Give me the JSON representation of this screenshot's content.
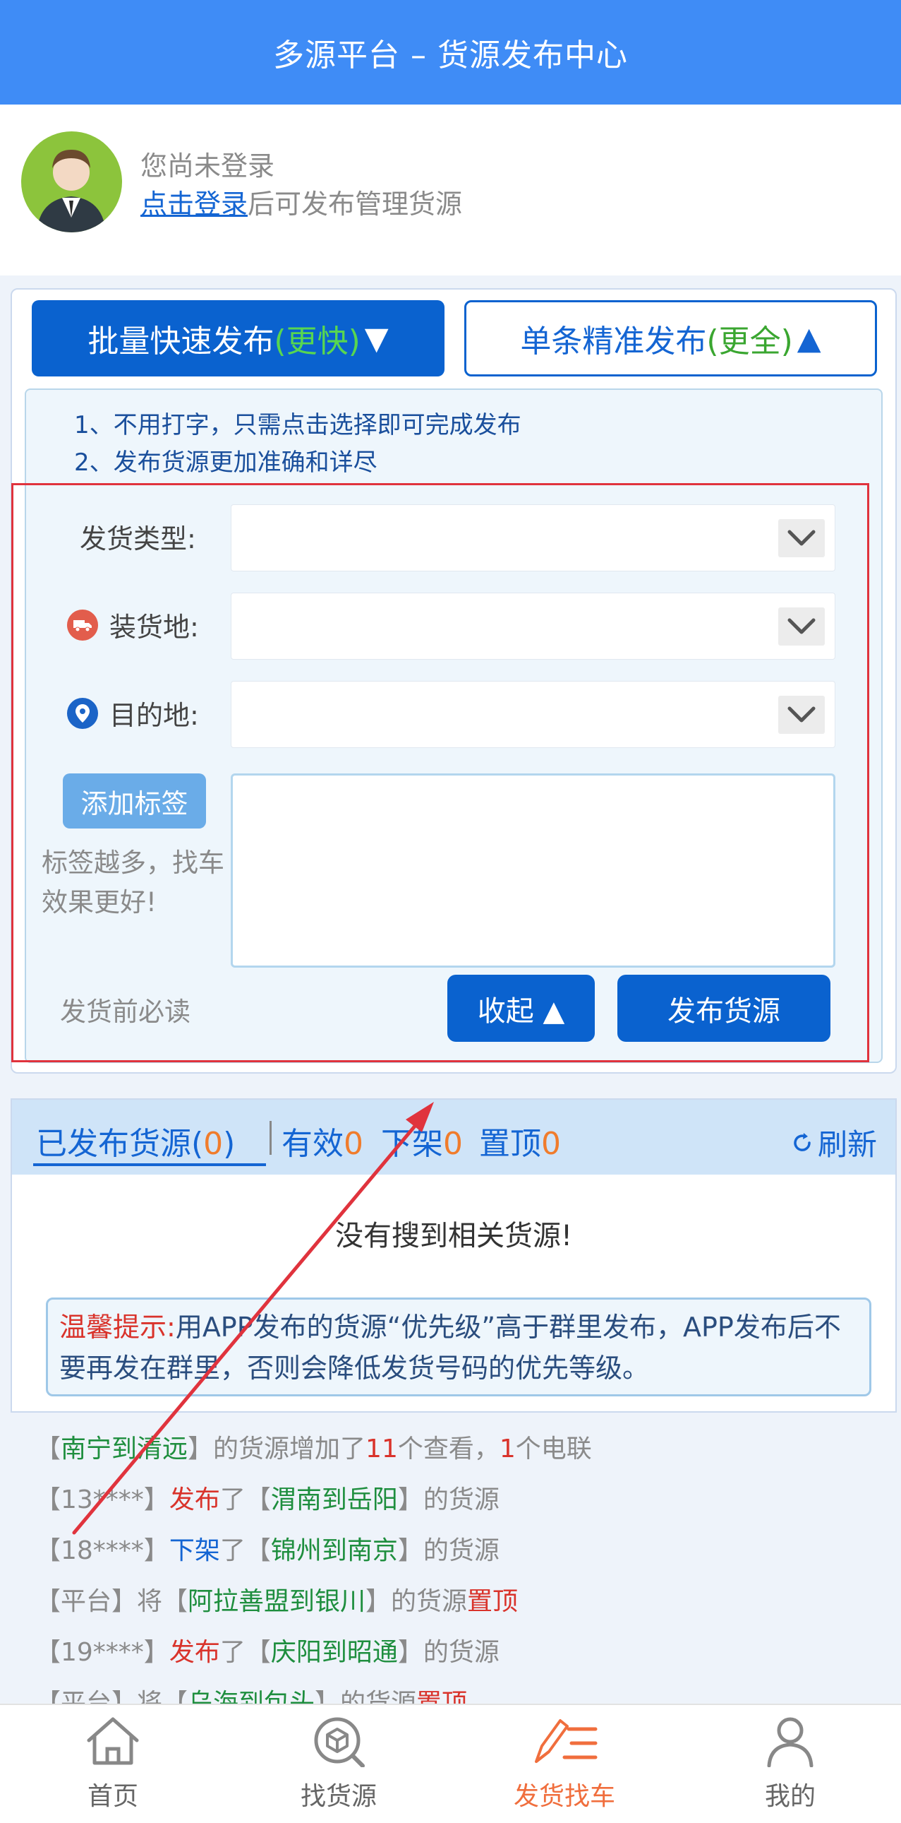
{
  "header": {
    "title": "多源平台 – 货源发布中心"
  },
  "user": {
    "status": "您尚未登录",
    "login_link": "点击登录",
    "login_suffix": "后可发布管理货源"
  },
  "publish": {
    "tab_quick": {
      "label": "批量快速发布",
      "hint": "(更快)",
      "arrow": "▼"
    },
    "tab_single": {
      "label": "单条精准发布",
      "hint": "(更全)",
      "arrow": "▲"
    },
    "tips": [
      "1、不用打字，只需点击选择即可完成发布",
      "2、发布货源更加准确和详尽"
    ],
    "form": {
      "ship_type_label": "发货类型:",
      "load_place_label": "装货地:",
      "destination_label": "目的地:",
      "add_tag_button": "添加标签",
      "tag_hint": "标签越多，找车效果更好!",
      "must_read": "发货前必读",
      "collapse_button": "收起 ▲",
      "publish_button": "发布货源"
    }
  },
  "list": {
    "tab_published": {
      "label": "已发布货源(",
      "count": "0",
      "suffix": ")"
    },
    "tab_valid": {
      "label": "有效",
      "count": "0"
    },
    "tab_offline": {
      "label": "下架",
      "count": "0"
    },
    "tab_top": {
      "label": "置顶",
      "count": "0"
    },
    "refresh": "刷新",
    "empty": "没有搜到相关货源!",
    "warm_label": "温馨提示:",
    "warm_text": "用APP发布的货源“优先级”高于群里发布，APP发布后不要再发在群里，否则会降低发货号码的优先等级。"
  },
  "feed": [
    {
      "a": "【",
      "b": "南宁到清远",
      "c": "】的货源增加了",
      "d": "11",
      "e": "个查看，",
      "f": "1",
      "g": "个电联"
    },
    {
      "user": "【13****】",
      "action": "发布",
      "mid": "了【",
      "route": "渭南到岳阳",
      "tail": "】的货源"
    },
    {
      "user": "【18****】",
      "action": "下架",
      "mid": "了【",
      "route": "锦州到南京",
      "tail": "】的货源"
    },
    {
      "user": "【平台】将【",
      "route": "阿拉善盟到银川",
      "tail": "】的货源",
      "action": "置顶"
    },
    {
      "user": "【19****】",
      "action": "发布",
      "mid": "了【",
      "route": "庆阳到昭通",
      "tail": "】的货源"
    },
    {
      "user": "【平台】将【",
      "route": "乌海到包头",
      "tail": "】的货源",
      "action": "置顶"
    }
  ],
  "nav": {
    "home": "首页",
    "find_goods": "找货源",
    "ship_find_truck": "发货找车",
    "mine": "我的"
  },
  "colors": {
    "brand_blue": "#0a62cf",
    "header_blue": "#3f8cf6",
    "accent_orange": "#f06e3d",
    "annotation_red": "#e0333d"
  }
}
